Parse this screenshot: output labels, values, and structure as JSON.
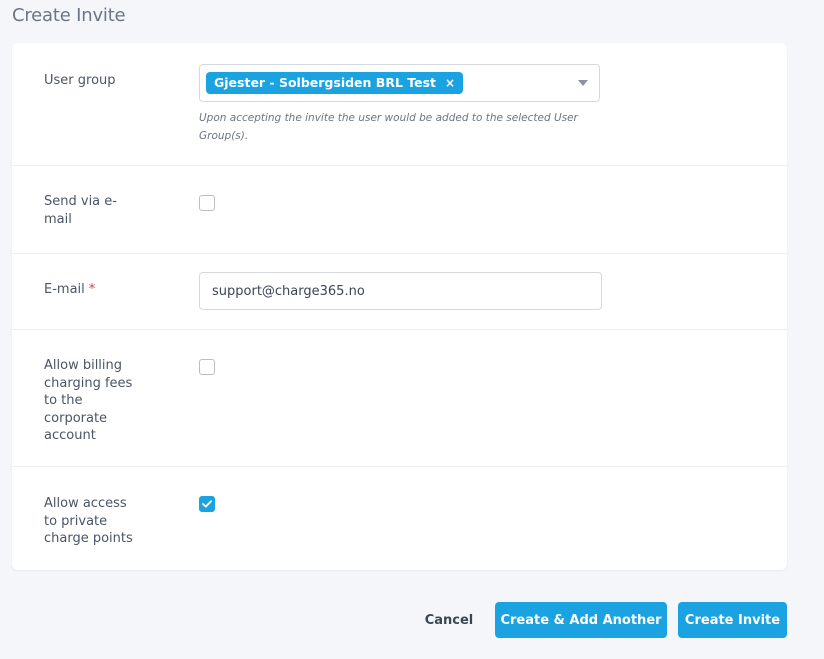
{
  "page": {
    "title": "Create Invite"
  },
  "form": {
    "user_group": {
      "label": "User group",
      "selected_tag": "Gjester - Solbergsiden BRL Test",
      "remove_glyph": "×",
      "help": "Upon accepting the invite the user would be added to the selected User Group(s)."
    },
    "send_email": {
      "label_line1": "Send via e-",
      "label_line2": "mail",
      "checked": false
    },
    "email": {
      "label": "E-mail",
      "required_marker": "*",
      "value": "support@charge365.no"
    },
    "allow_billing": {
      "label_lines": [
        "Allow billing",
        "charging fees",
        "to the",
        "corporate",
        "account"
      ],
      "checked": false
    },
    "allow_private": {
      "label_lines": [
        "Allow access",
        "to private",
        "charge points"
      ],
      "checked": true
    }
  },
  "actions": {
    "cancel": "Cancel",
    "create_add_another": "Create & Add Another",
    "create_invite": "Create Invite"
  },
  "colors": {
    "accent": "#1aa3e0",
    "required": "#e0394a",
    "background": "#f4f6f9"
  }
}
